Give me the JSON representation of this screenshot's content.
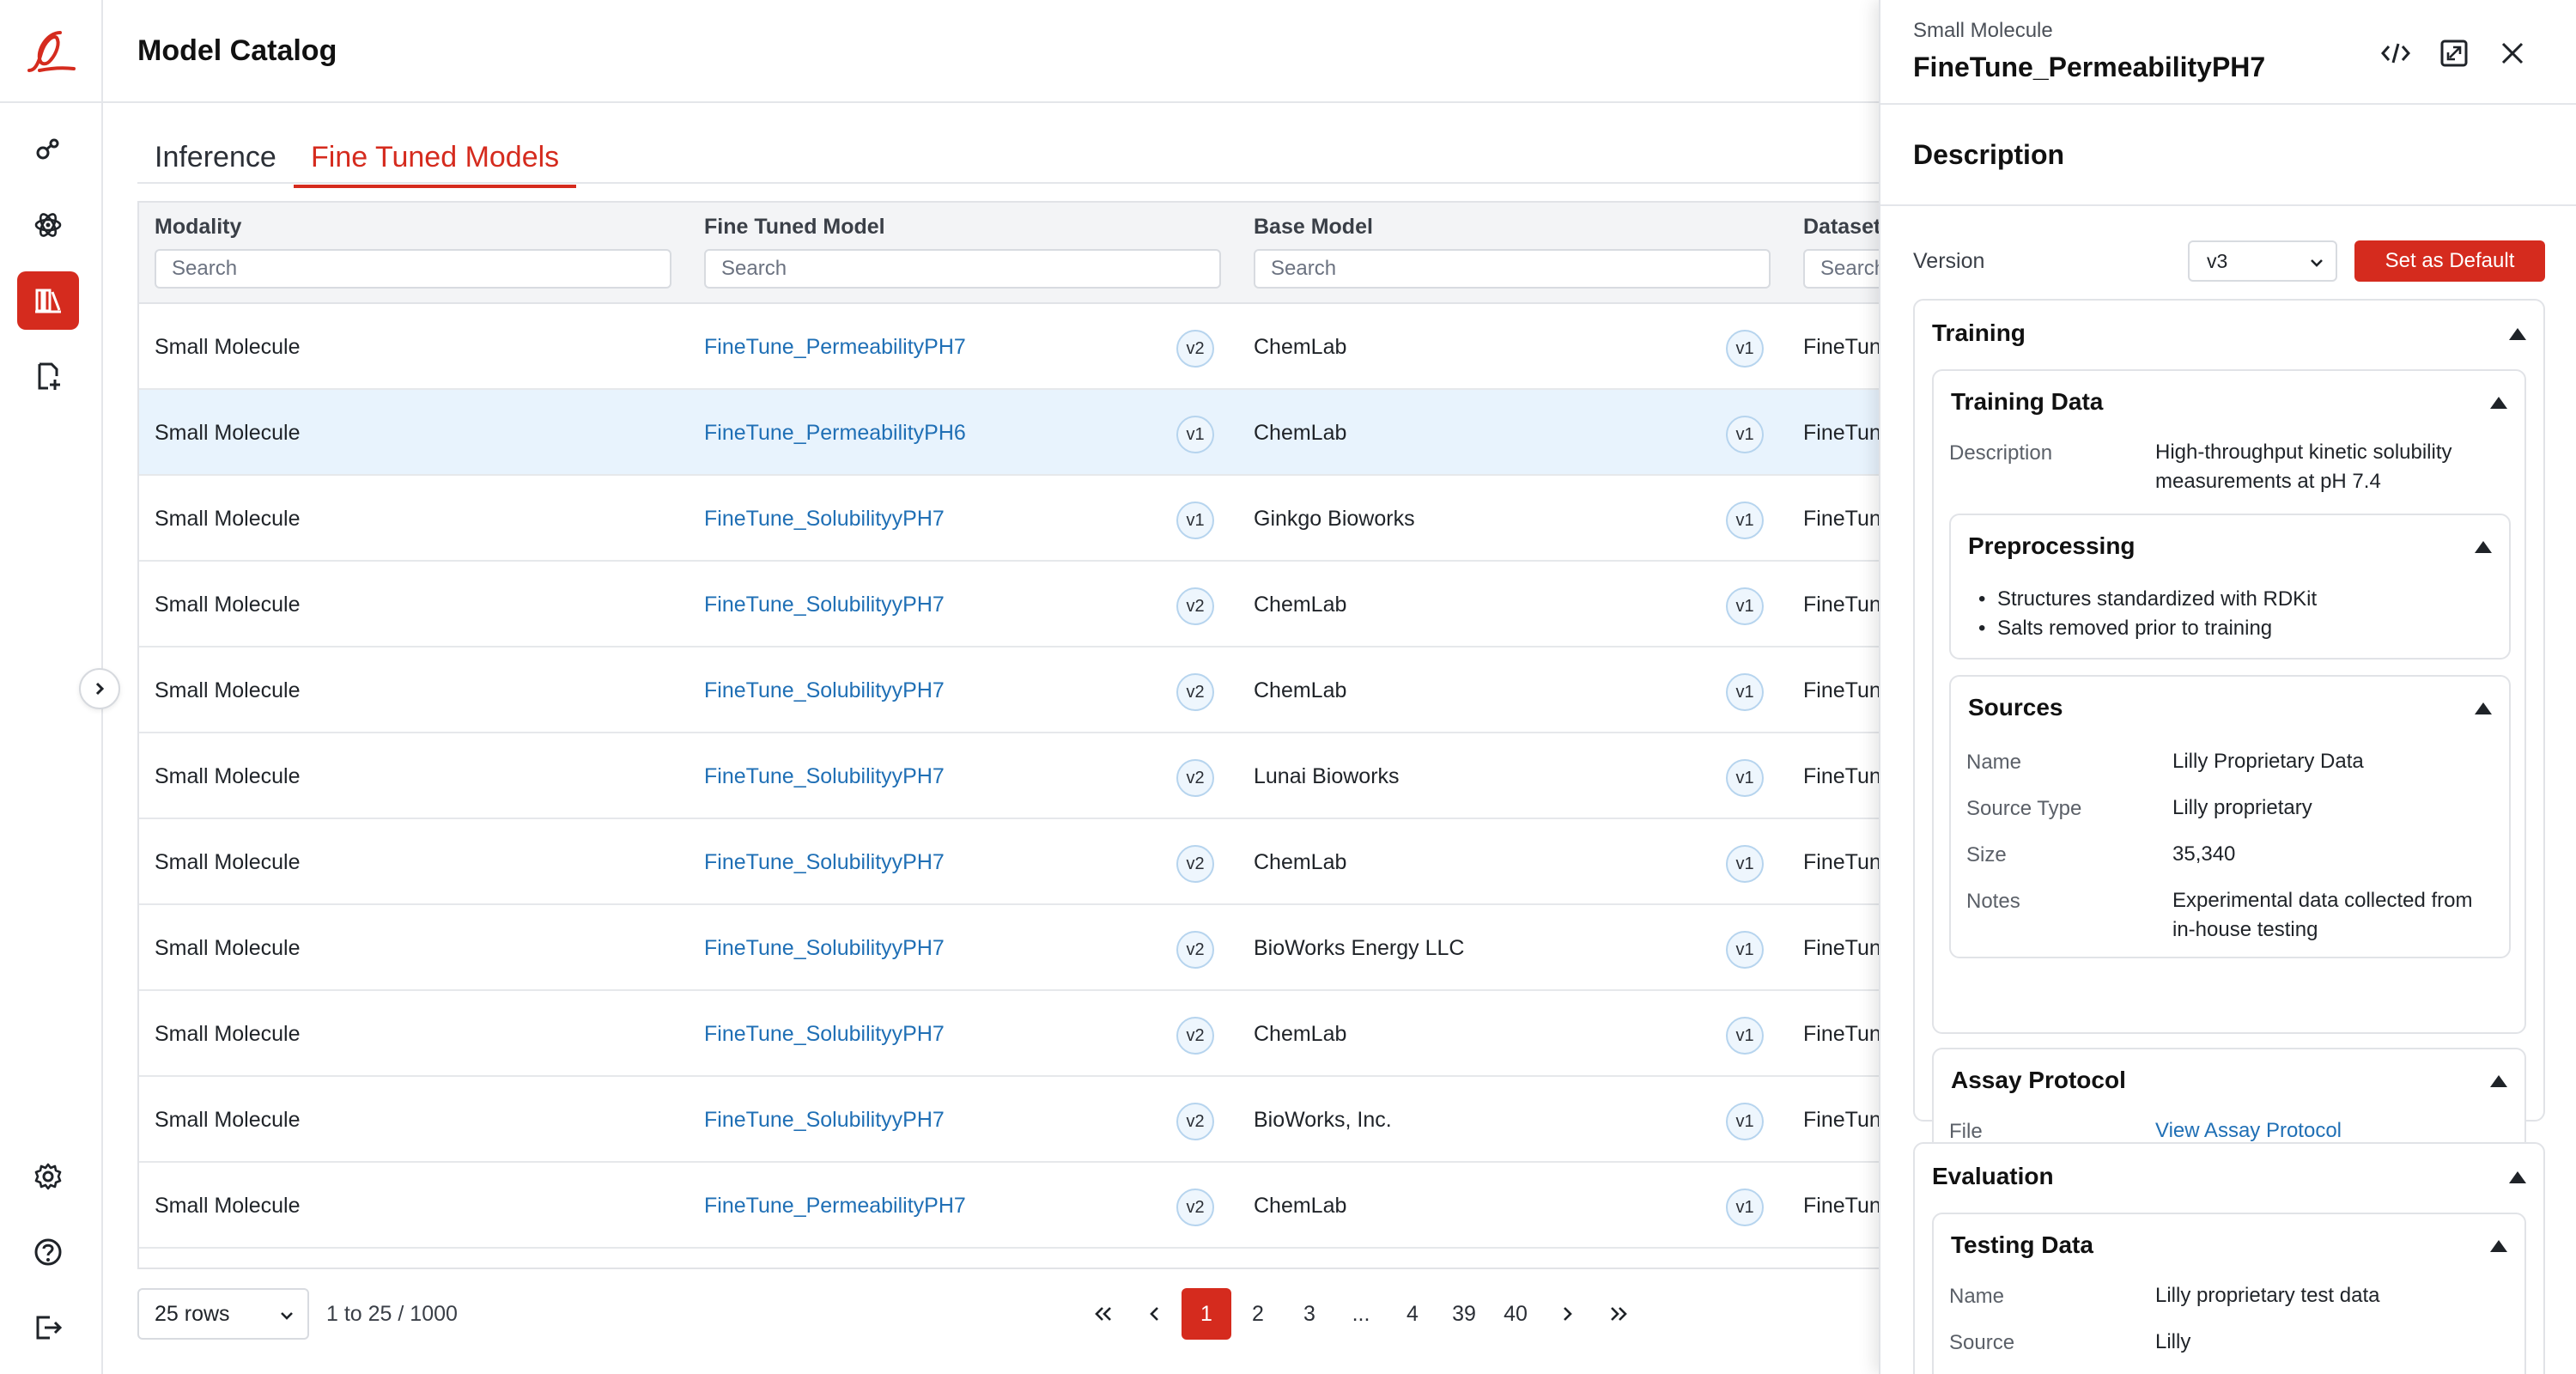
{
  "header": {
    "title": "Model Catalog"
  },
  "tabs": [
    {
      "label": "Inference"
    },
    {
      "label": "Fine Tuned Models"
    }
  ],
  "table": {
    "columns": [
      {
        "label": "Modality",
        "placeholder": "Search"
      },
      {
        "label": "Fine Tuned Model",
        "placeholder": "Search"
      },
      {
        "label": "Base Model",
        "placeholder": "Search"
      },
      {
        "label": "Dataset",
        "placeholder": "Search"
      }
    ],
    "rows": [
      {
        "modality": "Small Molecule",
        "model": "FineTune_PermeabilityPH7",
        "model_version": "v2",
        "base": "ChemLab",
        "base_version": "v1",
        "dataset": "FineTun"
      },
      {
        "modality": "Small Molecule",
        "model": "FineTune_PermeabilityPH6",
        "model_version": "v1",
        "base": "ChemLab",
        "base_version": "v1",
        "dataset": "FineTun"
      },
      {
        "modality": "Small Molecule",
        "model": "FineTune_SolubilityyPH7",
        "model_version": "v1",
        "base": "Ginkgo Bioworks",
        "base_version": "v1",
        "dataset": "FineTun"
      },
      {
        "modality": "Small Molecule",
        "model": "FineTune_SolubilityyPH7",
        "model_version": "v2",
        "base": "ChemLab",
        "base_version": "v1",
        "dataset": "FineTun"
      },
      {
        "modality": "Small Molecule",
        "model": "FineTune_SolubilityyPH7",
        "model_version": "v2",
        "base": "ChemLab",
        "base_version": "v1",
        "dataset": "FineTun"
      },
      {
        "modality": "Small Molecule",
        "model": "FineTune_SolubilityyPH7",
        "model_version": "v2",
        "base": "Lunai Bioworks",
        "base_version": "v1",
        "dataset": "FineTun"
      },
      {
        "modality": "Small Molecule",
        "model": "FineTune_SolubilityyPH7",
        "model_version": "v2",
        "base": "ChemLab",
        "base_version": "v1",
        "dataset": "FineTun"
      },
      {
        "modality": "Small Molecule",
        "model": "FineTune_SolubilityyPH7",
        "model_version": "v2",
        "base": "BioWorks Energy LLC",
        "base_version": "v1",
        "dataset": "FineTun"
      },
      {
        "modality": "Small Molecule",
        "model": "FineTune_SolubilityyPH7",
        "model_version": "v2",
        "base": "ChemLab",
        "base_version": "v1",
        "dataset": "FineTun"
      },
      {
        "modality": "Small Molecule",
        "model": "FineTune_SolubilityyPH7",
        "model_version": "v2",
        "base": "BioWorks, Inc.",
        "base_version": "v1",
        "dataset": "FineTun"
      },
      {
        "modality": "Small Molecule",
        "model": "FineTune_PermeabilityPH7",
        "model_version": "v2",
        "base": "ChemLab",
        "base_version": "v1",
        "dataset": "FineTun"
      }
    ]
  },
  "pagination": {
    "rows_per_page": "25 rows",
    "range": "1 to 25 / 1000",
    "pages": [
      "1",
      "2",
      "3",
      "...",
      "4",
      "39",
      "40"
    ],
    "current": "1"
  },
  "panel": {
    "subtitle": "Small Molecule",
    "title": "FineTune_PermeabilityPH7",
    "description_heading": "Description",
    "version_label": "Version",
    "version_value": "v3",
    "default_button": "Set as Default",
    "training": {
      "title": "Training",
      "training_data": {
        "title": "Training Data",
        "description_label": "Description",
        "description_value": "High-throughput kinetic solubility measurements at pH 7.4"
      },
      "preprocessing": {
        "title": "Preprocessing",
        "items": [
          "Structures standardized with RDKit",
          "Salts removed prior to training"
        ]
      },
      "sources": {
        "title": "Sources",
        "fields": [
          {
            "label": "Name",
            "value": "Lilly Proprietary Data"
          },
          {
            "label": "Source Type",
            "value": "Lilly proprietary"
          },
          {
            "label": "Size",
            "value": "35,340"
          },
          {
            "label": "Notes",
            "value": "Experimental data collected from in-house testing"
          }
        ]
      },
      "assay": {
        "title": "Assay Protocol",
        "file_label": "File",
        "file_link": "View Assay Protocol"
      }
    },
    "evaluation": {
      "title": "Evaluation",
      "testing_data": {
        "title": "Testing Data",
        "fields": [
          {
            "label": "Name",
            "value": "Lilly proprietary test data"
          },
          {
            "label": "Source",
            "value": "Lilly"
          }
        ]
      }
    }
  },
  "colors": {
    "accent": "#d52b1e",
    "link": "#1f6fb5",
    "selected_row": "#e8f3fd"
  },
  "icons": {
    "rail": [
      "lilly-logo",
      "nodes-icon",
      "atom-icon",
      "library-icon",
      "file-add-icon",
      "gear-icon",
      "help-icon",
      "logout-icon"
    ],
    "panel": [
      "code-icon",
      "expand-icon",
      "close-icon"
    ]
  }
}
